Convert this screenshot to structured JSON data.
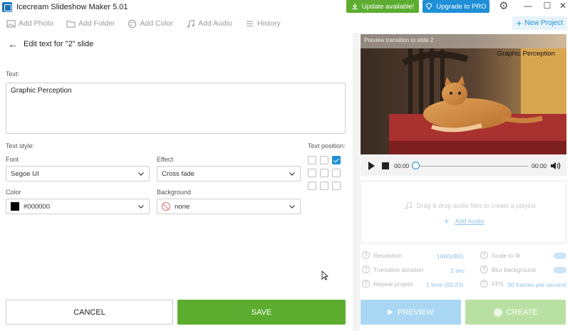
{
  "window": {
    "title": "Icecream Slideshow Maker 5.01",
    "update_label": "Update available!",
    "pro_label": "Upgrade to PRO",
    "new_project_label": "New Project"
  },
  "toolbar": {
    "items": [
      {
        "label": "Add Photo",
        "icon": "image-icon"
      },
      {
        "label": "Add Folder",
        "icon": "folder-icon"
      },
      {
        "label": "Add Color",
        "icon": "palette-icon"
      },
      {
        "label": "Add Audio",
        "icon": "music-icon"
      },
      {
        "label": "History",
        "icon": "list-icon"
      }
    ]
  },
  "editor": {
    "header": "Edit text for \"2\" slide",
    "text_label": "Text:",
    "text_value": "Graphic Perception",
    "style_label": "Text style:",
    "font_label": "Font",
    "font_value": "Segoe UI",
    "effect_label": "Effect",
    "effect_value": "Cross fade",
    "color_label": "Color",
    "color_value": "#000000",
    "background_label": "Background",
    "background_value": "none",
    "position_label": "Text position:",
    "position_selected": "top-right",
    "cancel_label": "CANCEL",
    "save_label": "SAVE"
  },
  "preview": {
    "caption": "Preview transition to slide 2",
    "overlay_text": "Graphic Perception",
    "time_current": "00:00",
    "time_total": "00:00",
    "progress": 0
  },
  "audio": {
    "drop_text": "Drag & drop audio files to create a playlist",
    "add_label": "Add Audio"
  },
  "settings": {
    "resolution_label": "Resolution",
    "resolution_value": "1600x900",
    "transition_label": "Transition duration",
    "transition_value": "2 sec",
    "repeat_label": "Repeat project",
    "repeat_value": "1 time (00:23)",
    "scale_label": "Scale to fit",
    "blur_label": "Blur background",
    "fps_label": "FPS",
    "fps_value": "30 frames per second"
  },
  "actions": {
    "preview_label": "PREVIEW",
    "create_label": "CREATE"
  },
  "colors": {
    "green": "#5cad2f",
    "blue": "#1e8fd6"
  }
}
